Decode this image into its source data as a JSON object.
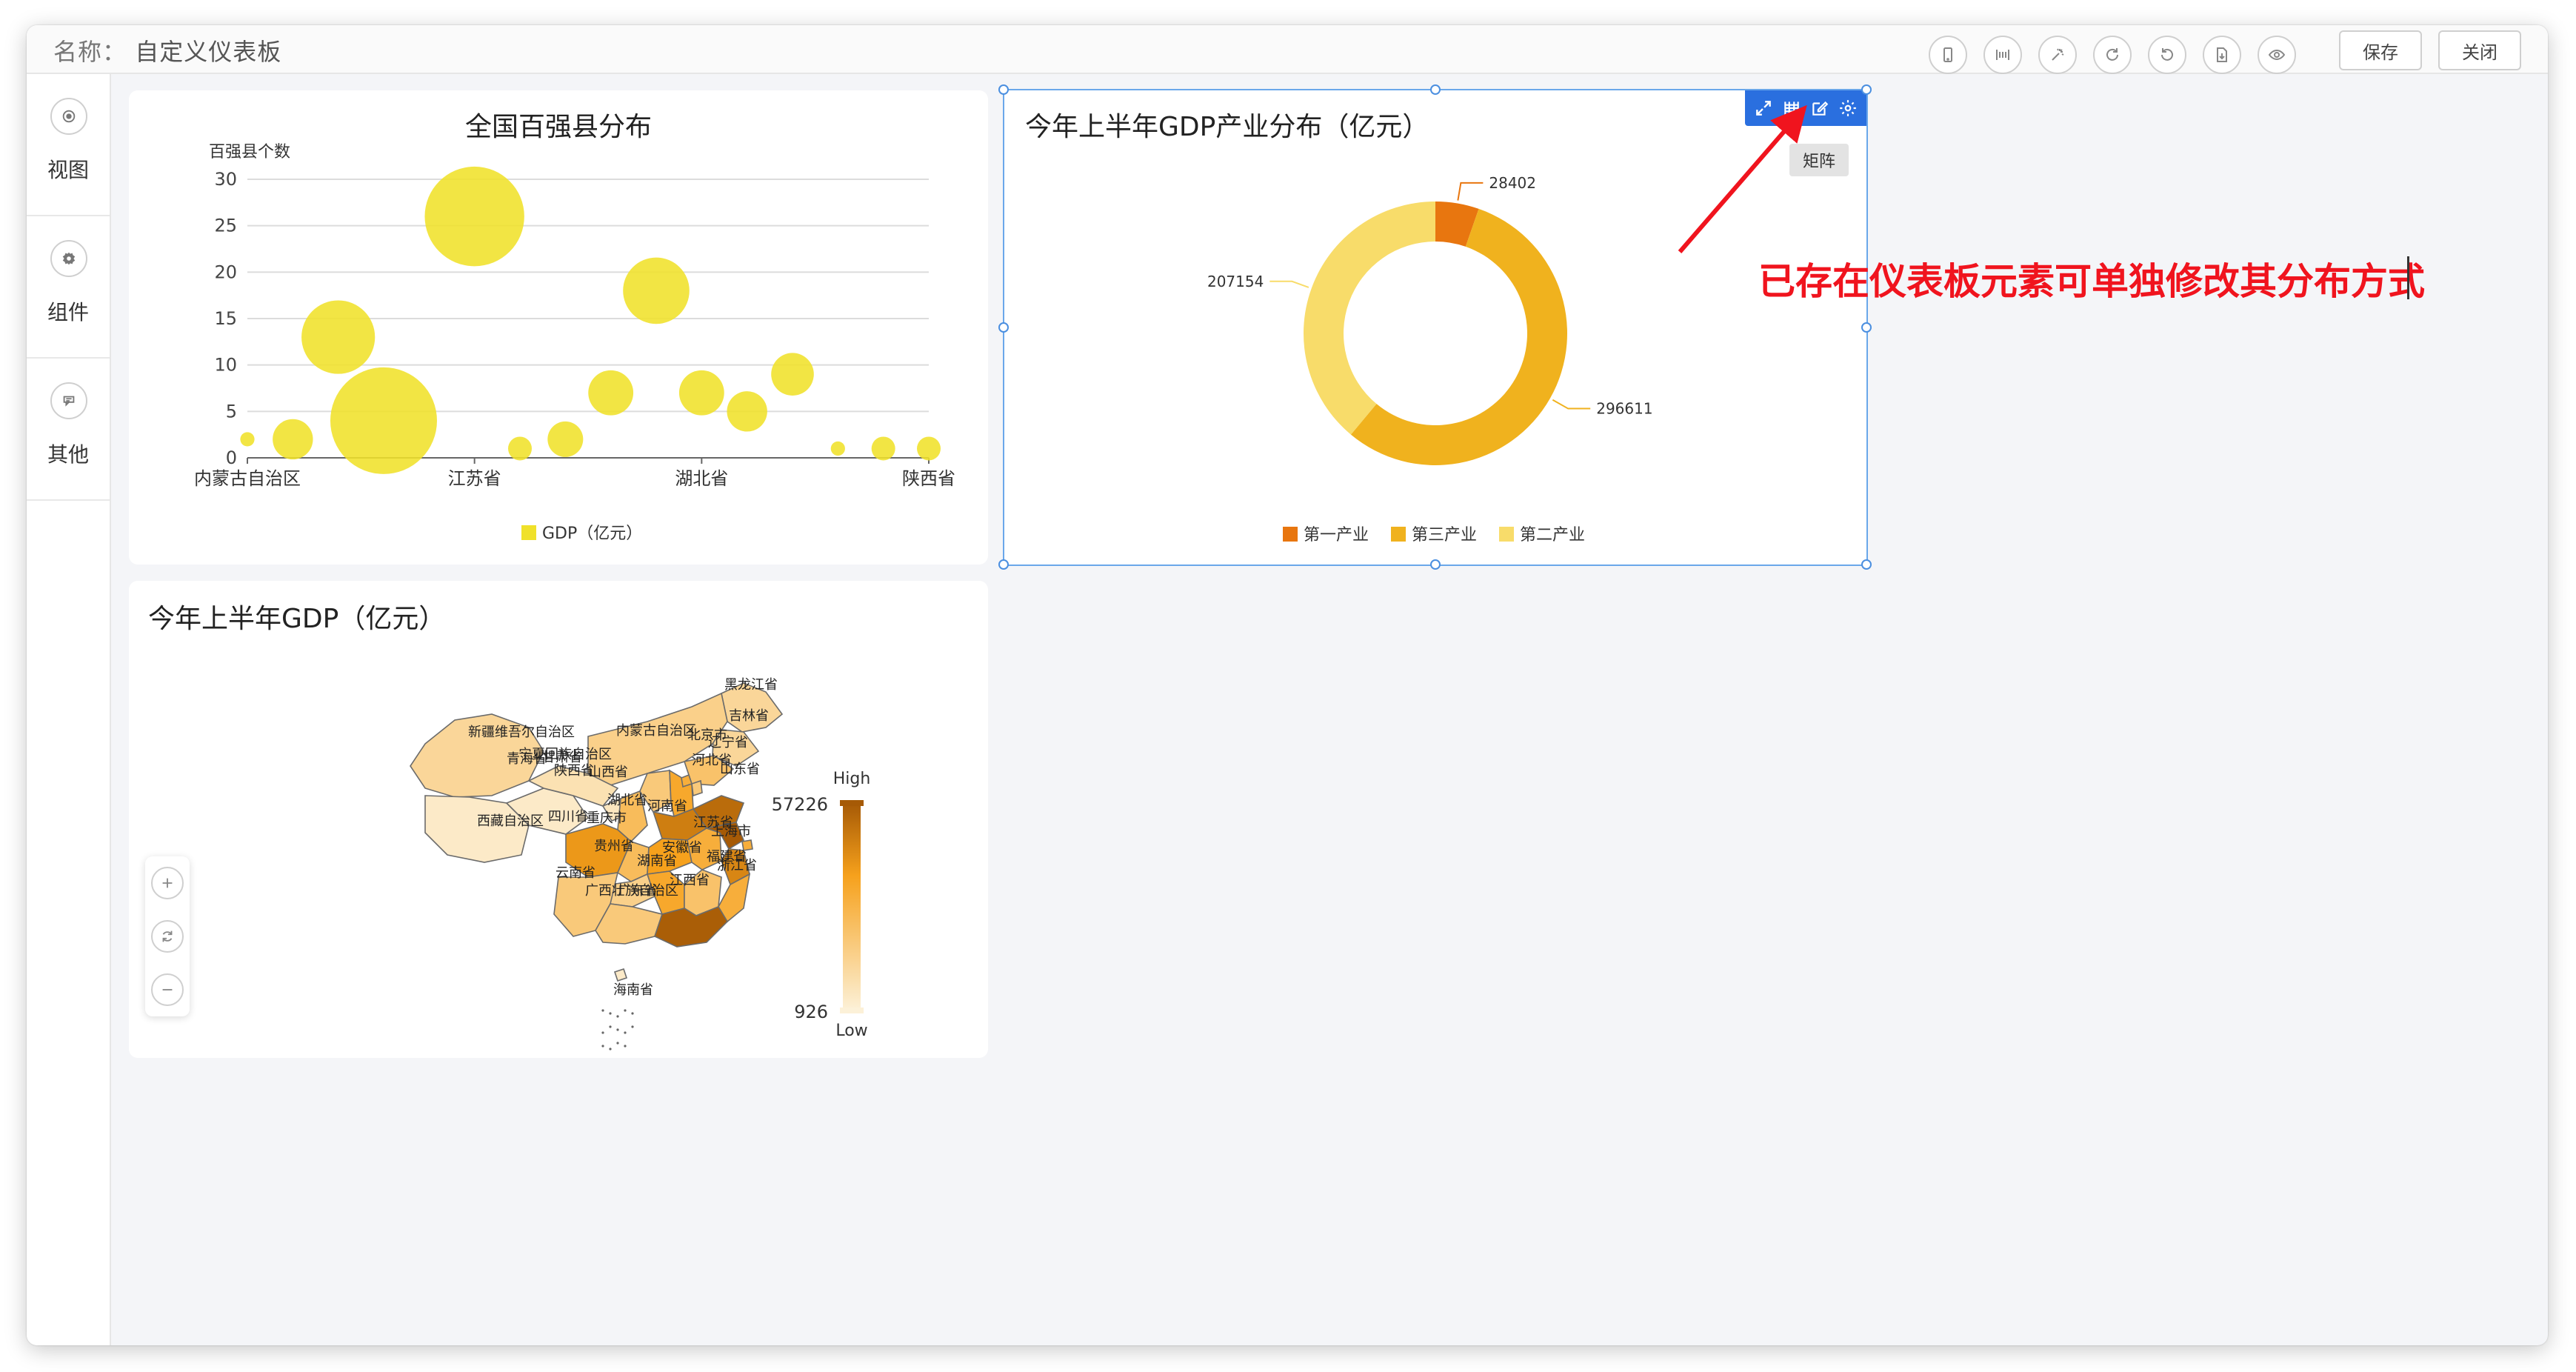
{
  "header": {
    "title_prefix": "名称：",
    "title_value": "自定义仪表板",
    "save_label": "保存",
    "close_label": "关闭",
    "tools": [
      "mobile-icon",
      "layout-icon",
      "magic-icon",
      "refresh-icon",
      "undo-icon",
      "export-icon",
      "preview-icon"
    ]
  },
  "sidebar": {
    "items": [
      {
        "label": "视图",
        "icon": "view-icon"
      },
      {
        "label": "组件",
        "icon": "component-icon"
      },
      {
        "label": "其他",
        "icon": "other-icon"
      }
    ]
  },
  "panels": {
    "bubble": {
      "title": "全国百强县分布"
    },
    "donut": {
      "title": "今年上半年GDP产业分布（亿元）",
      "tooltip": "矩阵"
    },
    "map": {
      "title": "今年上半年GDP（亿元）"
    }
  },
  "annotation": {
    "text": "已存在仪表板元素可单独修改其分布方式"
  },
  "chart_data": [
    {
      "type": "scatter",
      "subtype": "bubble",
      "title": "全国百强县分布",
      "ylabel": "百强县个数",
      "ylim": [
        0,
        30
      ],
      "yticks": [
        0,
        5,
        10,
        15,
        20,
        25,
        30
      ],
      "x_tick_labels": [
        "内蒙古自治区",
        "江苏省",
        "湖北省",
        "陕西省"
      ],
      "x_tick_index": [
        0,
        5,
        10,
        15
      ],
      "x_count": 16,
      "series": [
        {
          "name": "GDP（亿元）",
          "color": "#f0e12a"
        }
      ],
      "points": [
        {
          "x": 0,
          "y": 2,
          "size": 0.12
        },
        {
          "x": 1,
          "y": 2,
          "size": 0.34
        },
        {
          "x": 2,
          "y": 13,
          "size": 0.62
        },
        {
          "x": 3,
          "y": 4,
          "size": 0.9
        },
        {
          "x": 5,
          "y": 26,
          "size": 0.84
        },
        {
          "x": 6,
          "y": 1,
          "size": 0.2
        },
        {
          "x": 7,
          "y": 2,
          "size": 0.3
        },
        {
          "x": 8,
          "y": 7,
          "size": 0.38
        },
        {
          "x": 9,
          "y": 18,
          "size": 0.56
        },
        {
          "x": 10,
          "y": 7,
          "size": 0.38
        },
        {
          "x": 11,
          "y": 5,
          "size": 0.34
        },
        {
          "x": 12,
          "y": 9,
          "size": 0.36
        },
        {
          "x": 13,
          "y": 1,
          "size": 0.12
        },
        {
          "x": 14,
          "y": 1,
          "size": 0.2
        },
        {
          "x": 15,
          "y": 1,
          "size": 0.2
        }
      ],
      "legend_position": "bottom"
    },
    {
      "type": "pie",
      "subtype": "donut",
      "title": "今年上半年GDP产业分布（亿元）",
      "categories": [
        "第一产业",
        "第三产业",
        "第二产业"
      ],
      "values": [
        28402,
        296611,
        207154
      ],
      "colors": [
        "#e8760f",
        "#f0b21e",
        "#f8dc6a"
      ],
      "legend_position": "bottom"
    },
    {
      "type": "map",
      "title": "今年上半年GDP（亿元）",
      "visual_map": {
        "max": 57226,
        "min": 926,
        "high_label": "High",
        "low_label": "Low"
      },
      "regions": [
        {
          "name": "黑龙江省",
          "label": "黑龙江省",
          "level": 0.2
        },
        {
          "name": "吉林省",
          "label": "吉林省",
          "level": 0.2
        },
        {
          "name": "辽宁省",
          "label": "辽宁省",
          "level": 0.35
        },
        {
          "name": "内蒙古自治区",
          "label": "内蒙古自治区",
          "level": 0.25
        },
        {
          "name": "新疆维吾尔自治区",
          "label": "新疆维吾尔自治区",
          "level": 0.2
        },
        {
          "name": "西藏自治区",
          "label": "西藏自治区",
          "level": 0.05
        },
        {
          "name": "青海省",
          "label": "青海省",
          "level": 0.05
        },
        {
          "name": "甘肃省",
          "label": "甘肃省",
          "level": 0.12
        },
        {
          "name": "宁夏回族自治区",
          "label": "宁夏回族自治区",
          "level": 0.08
        },
        {
          "name": "陕西省",
          "label": "陕西省",
          "level": 0.4
        },
        {
          "name": "山西省",
          "label": "山西省",
          "level": 0.3
        },
        {
          "name": "河北省",
          "label": "河北省",
          "level": 0.55
        },
        {
          "name": "北京市",
          "label": "北京市",
          "level": 0.5
        },
        {
          "name": "天津市",
          "label": "天津市",
          "level": 0.3
        },
        {
          "name": "山东省",
          "label": "山东省",
          "level": 0.9
        },
        {
          "name": "河南省",
          "label": "河南省",
          "level": 0.8
        },
        {
          "name": "四川省",
          "label": "四川省",
          "level": 0.65
        },
        {
          "name": "重庆市",
          "label": "重庆市",
          "level": 0.4
        },
        {
          "name": "湖北省",
          "label": "湖北省",
          "level": 0.6
        },
        {
          "name": "安徽省",
          "label": "安徽省",
          "level": 0.5
        },
        {
          "name": "江苏省",
          "label": "江苏省",
          "level": 1.0
        },
        {
          "name": "上海市",
          "label": "上海市",
          "level": 0.5
        },
        {
          "name": "浙江省",
          "label": "浙江省",
          "level": 0.75
        },
        {
          "name": "贵州省",
          "label": "贵州省",
          "level": 0.25
        },
        {
          "name": "湖南省",
          "label": "湖南省",
          "level": 0.55
        },
        {
          "name": "江西省",
          "label": "江西省",
          "level": 0.35
        },
        {
          "name": "福建省",
          "label": "福建省",
          "level": 0.5
        },
        {
          "name": "云南省",
          "label": "云南省",
          "level": 0.3
        },
        {
          "name": "广西壮族自治区",
          "label": "广西壮族自治区",
          "level": 0.3
        },
        {
          "name": "广东省",
          "label": "广东省",
          "level": 0.98
        },
        {
          "name": "海南省",
          "label": "海南省",
          "level": 0.05
        }
      ]
    }
  ]
}
